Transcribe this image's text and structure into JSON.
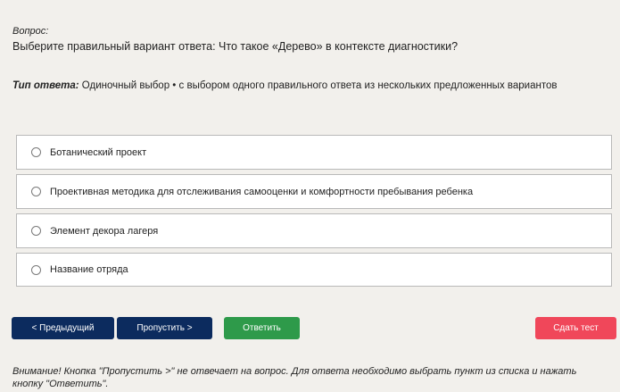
{
  "question": {
    "label": "Вопрос:",
    "text": "Выберите правильный вариант ответа: Что такое «Дерево» в контексте диагностики?"
  },
  "answer_type": {
    "label": "Тип ответа:",
    "value": "Одиночный выбор • с выбором одного правильного ответа из нескольких предложенных вариантов"
  },
  "options": [
    {
      "label": "Ботанический проект",
      "selected": false
    },
    {
      "label": "Проективная методика для отслеживания самооценки и комфортности пребывания ребенка",
      "selected": false
    },
    {
      "label": "Элемент декора лагеря",
      "selected": false
    },
    {
      "label": "Название отряда",
      "selected": false
    }
  ],
  "buttons": {
    "prev": "< Предыдущий",
    "skip": "Пропустить >",
    "answer": "Ответить",
    "finish": "Сдать тест"
  },
  "notice": "Внимание! Кнопка \"Пропустить >\" не отвечает на вопрос. Для ответа необходимо выбрать пункт из списка и нажать кнопку \"Ответить\".",
  "colors": {
    "background": "#f2f0ec",
    "primary_button": "#0c2b5e",
    "answer_button": "#2e9a4a",
    "finish_button": "#f0475a"
  }
}
